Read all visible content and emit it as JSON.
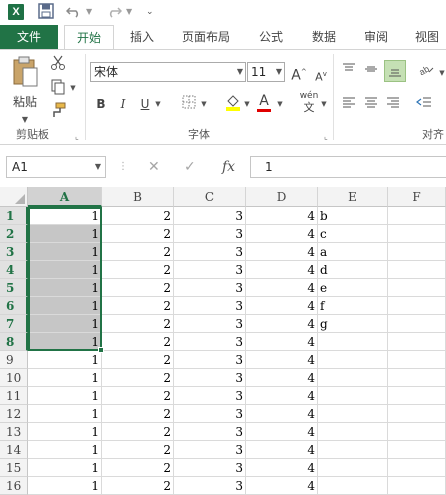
{
  "title_bar": {
    "app_logo": "X",
    "icons": [
      "excel-logo-icon",
      "save-icon",
      "undo-icon",
      "redo-icon",
      "customize-qat-icon"
    ]
  },
  "tabs": [
    {
      "label": "文件",
      "kind": "file"
    },
    {
      "label": "开始",
      "kind": "active"
    },
    {
      "label": "插入",
      "kind": ""
    },
    {
      "label": "页面布局",
      "kind": ""
    },
    {
      "label": "公式",
      "kind": ""
    },
    {
      "label": "数据",
      "kind": ""
    },
    {
      "label": "审阅",
      "kind": ""
    },
    {
      "label": "视图",
      "kind": ""
    }
  ],
  "ribbon": {
    "clipboard": {
      "paste_label": "粘贴",
      "group_label": "剪贴板"
    },
    "font": {
      "font_name": "宋体",
      "font_size": "11",
      "bold": "B",
      "italic": "I",
      "underline": "U",
      "grow": "A",
      "shrink": "A",
      "font_color_letter": "A",
      "phonetic": "wén",
      "group_label": "字体"
    },
    "alignment": {
      "group_label": "对齐"
    }
  },
  "formula_bar": {
    "name_box": "A1",
    "fx": "fx",
    "value": "1"
  },
  "grid": {
    "columns": [
      "A",
      "B",
      "C",
      "D",
      "E",
      "F"
    ],
    "selected_column": "A",
    "rows": [
      {
        "n": "1",
        "a": "1",
        "b": "2",
        "c": "3",
        "d": "4",
        "e": "b"
      },
      {
        "n": "2",
        "a": "1",
        "b": "2",
        "c": "3",
        "d": "4",
        "e": "c"
      },
      {
        "n": "3",
        "a": "1",
        "b": "2",
        "c": "3",
        "d": "4",
        "e": "a"
      },
      {
        "n": "4",
        "a": "1",
        "b": "2",
        "c": "3",
        "d": "4",
        "e": "d"
      },
      {
        "n": "5",
        "a": "1",
        "b": "2",
        "c": "3",
        "d": "4",
        "e": "e"
      },
      {
        "n": "6",
        "a": "1",
        "b": "2",
        "c": "3",
        "d": "4",
        "e": "f"
      },
      {
        "n": "7",
        "a": "1",
        "b": "2",
        "c": "3",
        "d": "4",
        "e": "g"
      },
      {
        "n": "8",
        "a": "1",
        "b": "2",
        "c": "3",
        "d": "4",
        "e": ""
      },
      {
        "n": "9",
        "a": "1",
        "b": "2",
        "c": "3",
        "d": "4",
        "e": ""
      },
      {
        "n": "10",
        "a": "1",
        "b": "2",
        "c": "3",
        "d": "4",
        "e": ""
      },
      {
        "n": "11",
        "a": "1",
        "b": "2",
        "c": "3",
        "d": "4",
        "e": ""
      },
      {
        "n": "12",
        "a": "1",
        "b": "2",
        "c": "3",
        "d": "4",
        "e": ""
      },
      {
        "n": "13",
        "a": "1",
        "b": "2",
        "c": "3",
        "d": "4",
        "e": ""
      },
      {
        "n": "14",
        "a": "1",
        "b": "2",
        "c": "3",
        "d": "4",
        "e": ""
      },
      {
        "n": "15",
        "a": "1",
        "b": "2",
        "c": "3",
        "d": "4",
        "e": ""
      },
      {
        "n": "16",
        "a": "1",
        "b": "2",
        "c": "3",
        "d": "4",
        "e": ""
      }
    ],
    "selected_rows": 8
  },
  "colors": {
    "accent": "#217346",
    "selection_fill": "#c6c6c6"
  }
}
